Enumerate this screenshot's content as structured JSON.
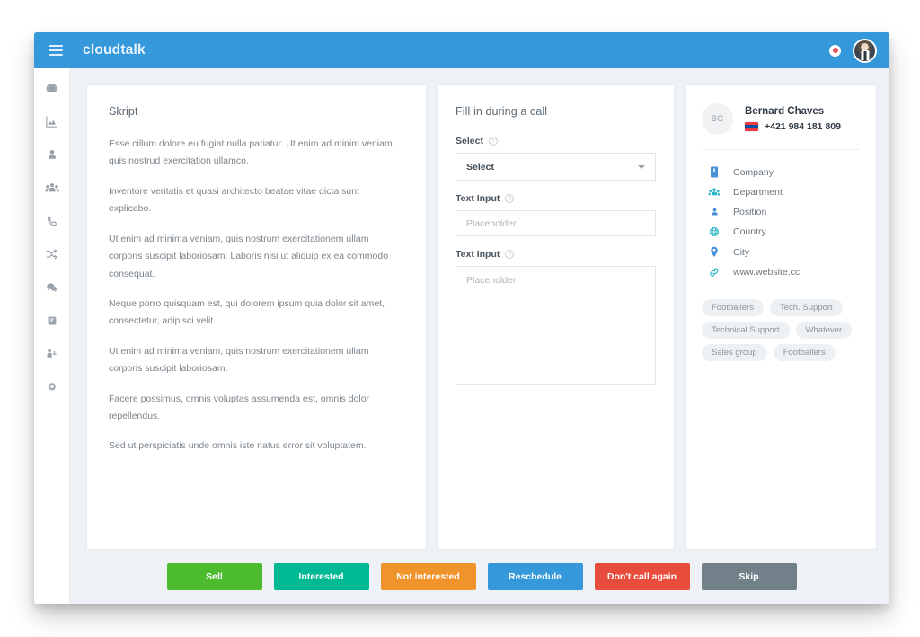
{
  "header": {
    "brand": "cloudtalk",
    "menu_icon": "hamburger-icon",
    "record_icon": "record-status-icon",
    "avatar_icon": "user-avatar"
  },
  "sidebar": {
    "items": [
      {
        "icon": "dashboard-icon",
        "name": "sidebar-item-dashboard"
      },
      {
        "icon": "analytics-icon",
        "name": "sidebar-item-analytics"
      },
      {
        "icon": "contact-icon",
        "name": "sidebar-item-contacts"
      },
      {
        "icon": "group-icon",
        "name": "sidebar-item-groups"
      },
      {
        "icon": "phone-icon",
        "name": "sidebar-item-calls"
      },
      {
        "icon": "shuffle-icon",
        "name": "sidebar-item-routing"
      },
      {
        "icon": "chat-icon",
        "name": "sidebar-item-messages"
      },
      {
        "icon": "book-icon",
        "name": "sidebar-item-library"
      },
      {
        "icon": "workflow-icon",
        "name": "sidebar-item-workflow"
      },
      {
        "icon": "gear-icon",
        "name": "sidebar-item-settings"
      }
    ]
  },
  "script_panel": {
    "title": "Skript",
    "paragraphs": [
      "Esse cillum dolore eu fugiat nulla pariatur. Ut enim ad minim veniam, quis nostrud exercitation ullamco.",
      "Inventore veritatis et quasi architecto beatae vitae dicta sunt explicabo.",
      "Ut enim ad minima veniam, quis nostrum exercitationem ullam corporis suscipit laboriosam. Laboris nisi ut aliquip ex ea commodo consequat.",
      "Neque porro quisquam est, qui dolorem ipsum quia dolor sit amet, consectetur, adipisci velit.",
      "Ut enim ad minima veniam, quis nostrum exercitationem ullam corporis suscipit laboriosam.",
      "Facere possimus, omnis voluptas assumenda est, omnis dolor repellendus.",
      "Sed ut perspiciatis unde omnis iste natus error sit voluptatem."
    ]
  },
  "form_panel": {
    "title": "Fill in during a call",
    "select_field": {
      "label": "Select",
      "help_glyph": "?",
      "value": "Select",
      "caret_icon": "chevron-down-icon"
    },
    "text_field": {
      "label": "Text Input",
      "help_glyph": "?",
      "value": "",
      "placeholder": "Placeholder"
    },
    "textarea_field": {
      "label": "Text Input",
      "help_glyph": "?",
      "value": "",
      "placeholder": "Placeholder"
    }
  },
  "contact_panel": {
    "initials": "BC",
    "name": "Bernard Chaves",
    "phone": "+421 984 181 809",
    "flag": "slovakia-flag-icon",
    "details": [
      {
        "icon": "building-icon",
        "label": "Company",
        "color": "#4a90d9"
      },
      {
        "icon": "group-icon",
        "label": "Department",
        "color": "#29b6c4"
      },
      {
        "icon": "person-icon",
        "label": "Position",
        "color": "#4a90d9"
      },
      {
        "icon": "globe-icon",
        "label": "Country",
        "color": "#29b6c4"
      },
      {
        "icon": "pin-icon",
        "label": "City",
        "color": "#4a90d9"
      },
      {
        "icon": "link-icon",
        "label": "www.website.cc",
        "color": "#29b6c4"
      }
    ],
    "tags": [
      "Footballers",
      "Tech. Support",
      "Technical Support",
      "Whatever",
      "Sales group",
      "Footballers"
    ]
  },
  "footer": {
    "buttons": [
      {
        "label": "Sell",
        "color": "#4cbb2e"
      },
      {
        "label": "Interested",
        "color": "#00b894"
      },
      {
        "label": "Not interested",
        "color": "#f0932b"
      },
      {
        "label": "Reschedule",
        "color": "#3498db"
      },
      {
        "label": "Don't call again",
        "color": "#e74c3c"
      },
      {
        "label": "Skip",
        "color": "#718089"
      }
    ]
  }
}
